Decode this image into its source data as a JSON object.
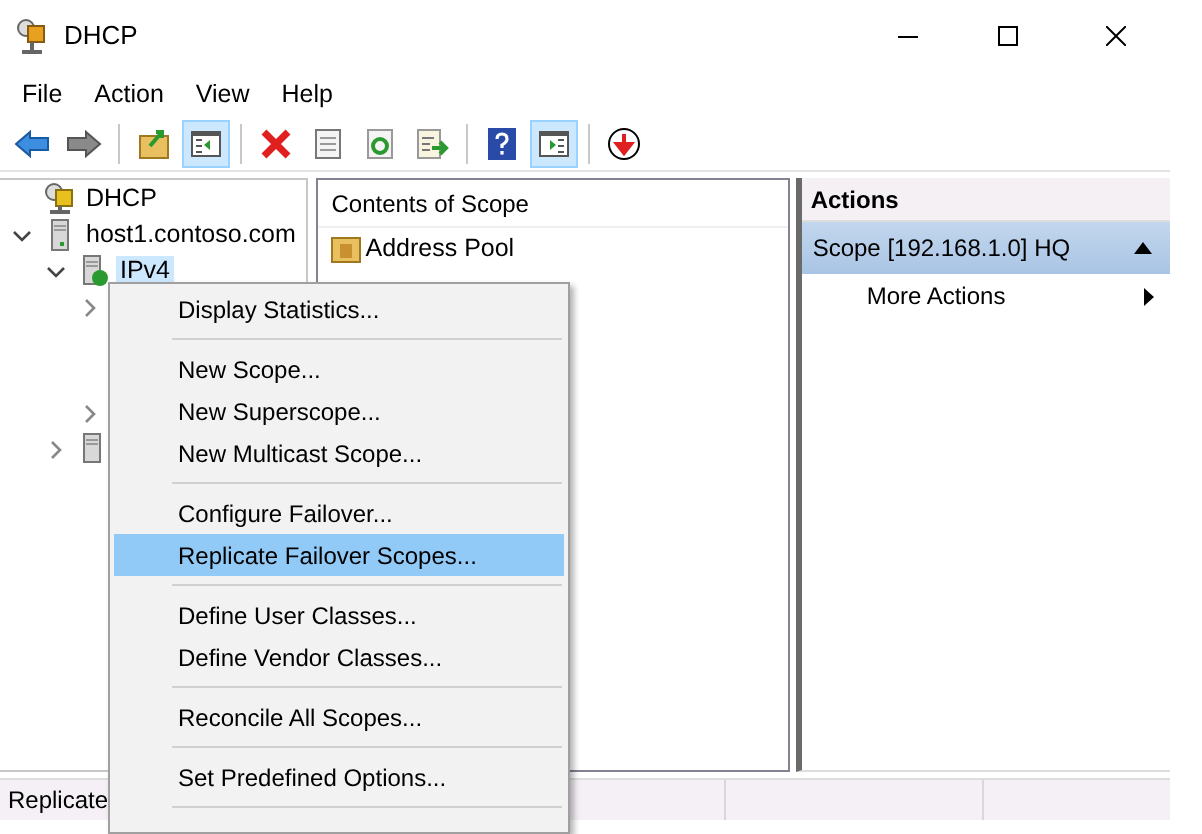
{
  "window": {
    "title": "DHCP"
  },
  "menu_bar": [
    "File",
    "Action",
    "View",
    "Help"
  ],
  "toolbar": [
    {
      "kind": "back"
    },
    {
      "kind": "forward"
    },
    {
      "kind": "separator"
    },
    {
      "kind": "up"
    },
    {
      "kind": "tree",
      "pressed": true
    },
    {
      "kind": "separator"
    },
    {
      "kind": "delete"
    },
    {
      "kind": "properties"
    },
    {
      "kind": "refresh"
    },
    {
      "kind": "export"
    },
    {
      "kind": "separator"
    },
    {
      "kind": "help"
    },
    {
      "kind": "actionpane",
      "pressed": true
    },
    {
      "kind": "separator"
    },
    {
      "kind": "download"
    }
  ],
  "tree": [
    {
      "label": "DHCP",
      "kind": "root",
      "children": [
        {
          "label": "host1.contoso.com",
          "kind": "server",
          "expanded": true,
          "children": [
            {
              "label": "IPv4",
              "kind": "ipv4",
              "expanded": true,
              "selected": true,
              "children": [
                {
                  "expanded": false
                },
                {
                  "expanded": false
                }
              ]
            },
            {
              "kind": "ipv6",
              "expanded": false
            }
          ]
        }
      ]
    }
  ],
  "content": {
    "header": "Contents of Scope",
    "items": [
      "Address Pool"
    ]
  },
  "actions": {
    "title": "Actions",
    "section": {
      "label": "Scope [192.168.1.0] HQ",
      "expanded": true
    },
    "items": [
      "More Actions"
    ]
  },
  "context_menu": [
    {
      "label": "Display Statistics...",
      "selected": false
    },
    {
      "kind": "separator"
    },
    {
      "label": "New Scope...",
      "selected": false
    },
    {
      "label": "New Superscope...",
      "selected": false
    },
    {
      "label": "New Multicast Scope...",
      "selected": false
    },
    {
      "kind": "separator"
    },
    {
      "label": "Configure Failover...",
      "selected": false
    },
    {
      "label": "Replicate Failover Scopes...",
      "selected": true
    },
    {
      "kind": "separator"
    },
    {
      "label": "Define User Classes...",
      "selected": false
    },
    {
      "label": "Define Vendor Classes...",
      "selected": false
    },
    {
      "kind": "separator"
    },
    {
      "label": "Reconcile All Scopes...",
      "selected": false
    },
    {
      "kind": "separator"
    },
    {
      "label": "Set Predefined Options...",
      "selected": false
    },
    {
      "kind": "separator"
    }
  ],
  "status_bar": "Replicate"
}
